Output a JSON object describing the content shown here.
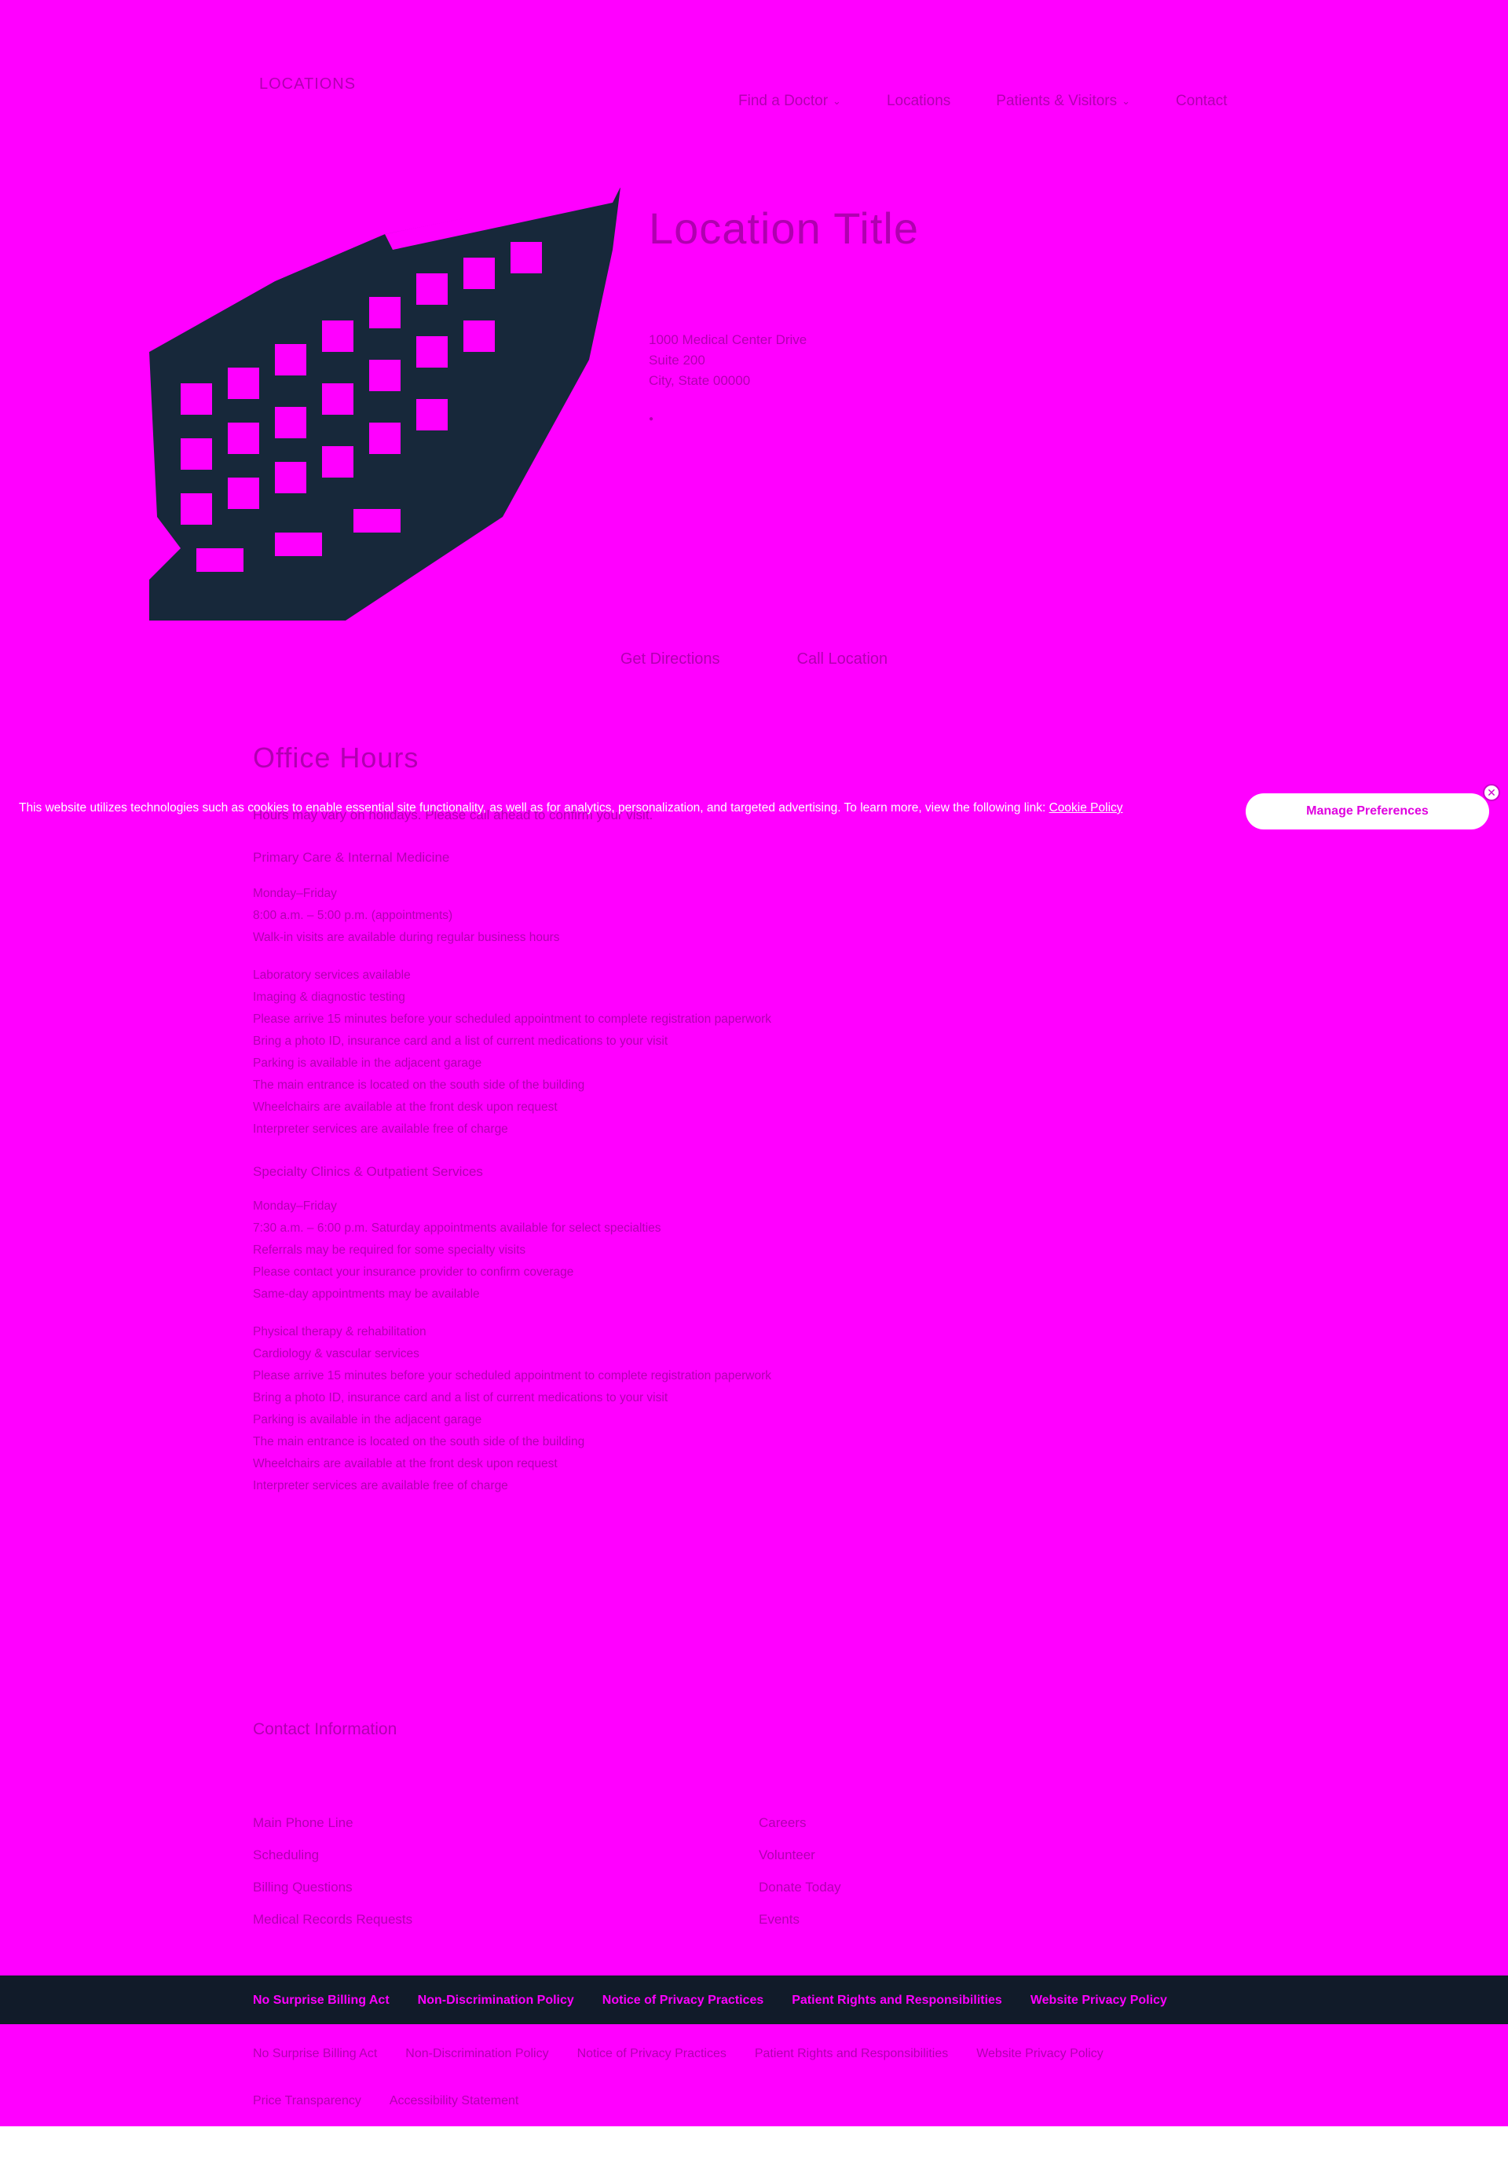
{
  "header": {
    "logo_text": "LOCATIONS",
    "nav": [
      {
        "label": "Find a Doctor",
        "has_dropdown": true
      },
      {
        "label": "Locations",
        "has_dropdown": false
      },
      {
        "label": "Patients & Visitors",
        "has_dropdown": true
      },
      {
        "label": "Contact",
        "has_dropdown": false
      }
    ]
  },
  "hero": {
    "title": "Location Title",
    "address_lines": [
      "1000 Medical Center Drive",
      "Suite 200",
      "City, State 00000"
    ],
    "links": [
      "Get Directions",
      "Call Location"
    ]
  },
  "content": {
    "section_title": "Office Hours",
    "faded_line": "Hours may vary on holidays. Please call ahead to confirm your visit.",
    "subhead_1": "Primary Care & Internal Medicine",
    "group_1a": [
      "Monday–Friday",
      "8:00 a.m. – 5:00 p.m. (appointments)",
      "Walk-in visits are available during regular business hours"
    ],
    "group_1b": [
      "Laboratory services available",
      "Imaging & diagnostic testing",
      "Please arrive 15 minutes before your scheduled appointment to complete registration paperwork",
      "Bring a photo ID, insurance card and a list of current medications to your visit",
      "Parking is available in the adjacent garage",
      "The main entrance is located on the south side of the building",
      "Wheelchairs are available at the front desk upon request",
      "Interpreter services are available free of charge"
    ],
    "subhead_2": "Specialty Clinics & Outpatient Services",
    "group_2a": [
      "Monday–Friday",
      "7:30 a.m. – 6:00 p.m. Saturday appointments available for select specialties",
      "Referrals may be required for some specialty visits",
      "Please contact your insurance provider to confirm coverage",
      "Same-day appointments may be available"
    ],
    "group_2b": [
      "Physical therapy & rehabilitation",
      "Cardiology & vascular services",
      "Please arrive 15 minutes before your scheduled appointment to complete registration paperwork",
      "Bring a photo ID, insurance card and a list of current medications to your visit",
      "Parking is available in the adjacent garage",
      "The main entrance is located on the south side of the building",
      "Wheelchairs are available at the front desk upon request",
      "Interpreter services are available free of charge"
    ]
  },
  "cookie": {
    "text": "This website utilizes technologies such as cookies to enable essential site functionality, as well as for analytics, personalization, and targeted advertising. To learn more, view the following link:",
    "link_label": "Cookie Policy",
    "button_label": "Manage Preferences",
    "close_glyph": "✕"
  },
  "directory": {
    "heading": "Contact Information",
    "col_1": [
      "Main Phone Line",
      "Scheduling",
      "Billing Questions",
      "Medical Records Requests"
    ],
    "col_2": [
      "Careers",
      "Volunteer",
      "Donate Today",
      "Events"
    ]
  },
  "footer": {
    "links": [
      "No Surprise Billing Act",
      "Non-Discrimination Policy",
      "Notice of Privacy Practices",
      "Patient Rights and Responsibilities",
      "Website Privacy Policy"
    ],
    "links_row2": [
      "No Surprise Billing Act",
      "Non-Discrimination Policy",
      "Notice of Privacy Practices",
      "Patient Rights and Responsibilities",
      "Website Privacy Policy"
    ],
    "links_row3": [
      "Price Transparency",
      "Accessibility Statement"
    ]
  },
  "colors": {
    "background": "#ff00ff",
    "footer_bar": "#111b29",
    "button": "#ffffff"
  }
}
